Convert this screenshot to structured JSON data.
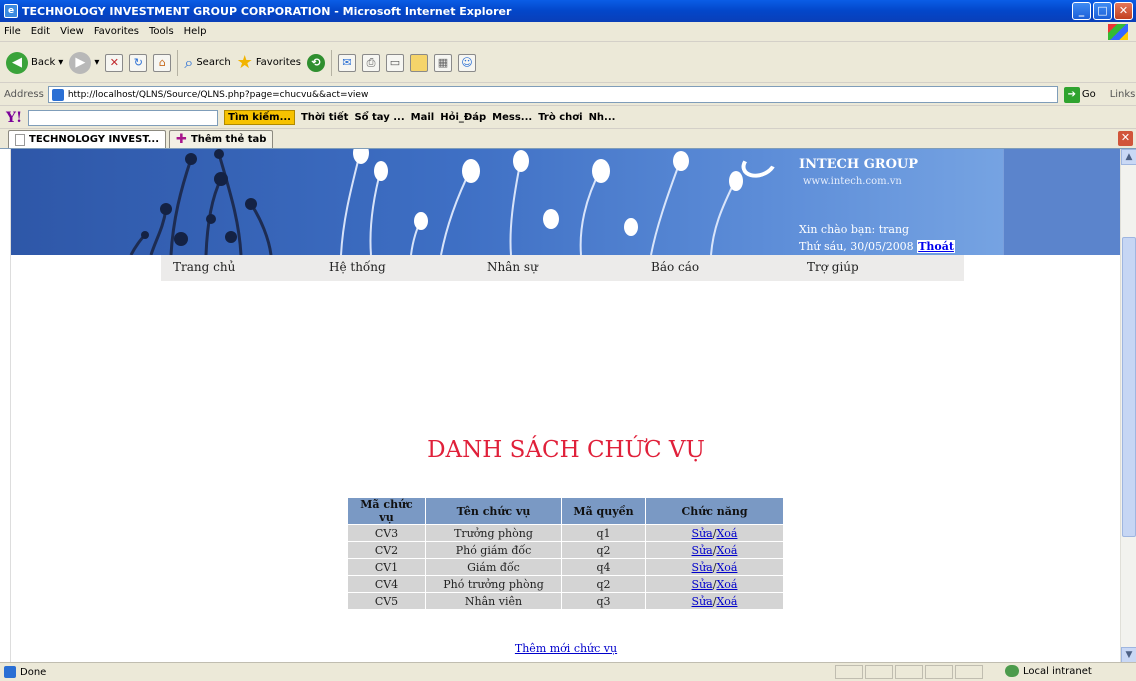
{
  "window": {
    "title": "TECHNOLOGY INVESTMENT GROUP CORPORATION - Microsoft Internet Explorer"
  },
  "menu": [
    "File",
    "Edit",
    "View",
    "Favorites",
    "Tools",
    "Help"
  ],
  "toolbar": {
    "back_label": "Back",
    "search_label": "Search",
    "favorites_label": "Favorites"
  },
  "address": {
    "label": "Address",
    "url": "http://localhost/QLNS/Source/QLNS.php?page=chucvu&&act=view",
    "go_label": "Go",
    "links_label": "Links"
  },
  "yahoo_bar": {
    "find_label": "Tìm kiếm...",
    "items": [
      "Thời tiết",
      "Sổ tay ...",
      "Mail",
      "Hỏi_Đáp",
      "Mess...",
      "Trò chơi",
      "Nh..."
    ]
  },
  "tabs": {
    "active": "TECHNOLOGY INVEST...",
    "new_tab": "Thêm thẻ tab"
  },
  "header": {
    "brand": "INTECH GROUP",
    "url": "www.intech.com.vn",
    "greeting": "Xin chào bạn: trang",
    "date": "Thứ sáu, 30/05/2008",
    "logout": "Thoát"
  },
  "nav": [
    "Trang chủ",
    "Hệ thống",
    "Nhân sự",
    "Báo cáo",
    "Trợ giúp"
  ],
  "main": {
    "heading": "DANH SÁCH CHỨC VỤ",
    "columns": [
      "Mã chức vụ",
      "Tên chức vụ",
      "Mã quyền",
      "Chức năng"
    ],
    "rows": [
      {
        "code": "CV3",
        "name": "Trưởng phòng",
        "perm": "q1"
      },
      {
        "code": "CV2",
        "name": "Phó giám đốc",
        "perm": "q2"
      },
      {
        "code": "CV1",
        "name": "Giám đốc",
        "perm": "q4"
      },
      {
        "code": "CV4",
        "name": "Phó trưởng phòng",
        "perm": "q2"
      },
      {
        "code": "CV5",
        "name": "Nhân viên",
        "perm": "q3"
      }
    ],
    "edit_label": "Sửa",
    "slash": "/",
    "delete_label": "Xoá",
    "add_link": "Thêm mới chức vụ"
  },
  "status": {
    "text": "Done",
    "zone": "Local intranet"
  }
}
